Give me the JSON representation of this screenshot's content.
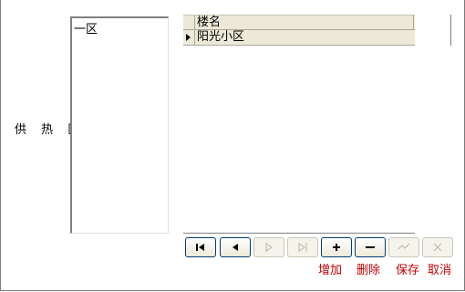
{
  "district": {
    "label": "供 热 区",
    "items": [
      "一区"
    ]
  },
  "grid": {
    "columns": [
      "楼名"
    ],
    "rows": [
      [
        "阳光小区"
      ]
    ]
  },
  "navigator": {
    "buttons": [
      {
        "name": "first-record-icon",
        "enabled": true
      },
      {
        "name": "prior-record-icon",
        "enabled": true
      },
      {
        "name": "next-record-icon",
        "enabled": false
      },
      {
        "name": "last-record-icon",
        "enabled": false
      },
      {
        "name": "insert-record-icon",
        "enabled": true
      },
      {
        "name": "delete-record-icon",
        "enabled": true
      },
      {
        "name": "post-record-icon",
        "enabled": false
      },
      {
        "name": "cancel-record-icon",
        "enabled": false
      }
    ],
    "captions": {
      "add": "增加",
      "delete": "删除",
      "save": "保存",
      "cancel": "取消"
    }
  },
  "colors": {
    "caption": "#c00000",
    "header_bg": "#ece9d8",
    "button_border": "#003c74"
  }
}
